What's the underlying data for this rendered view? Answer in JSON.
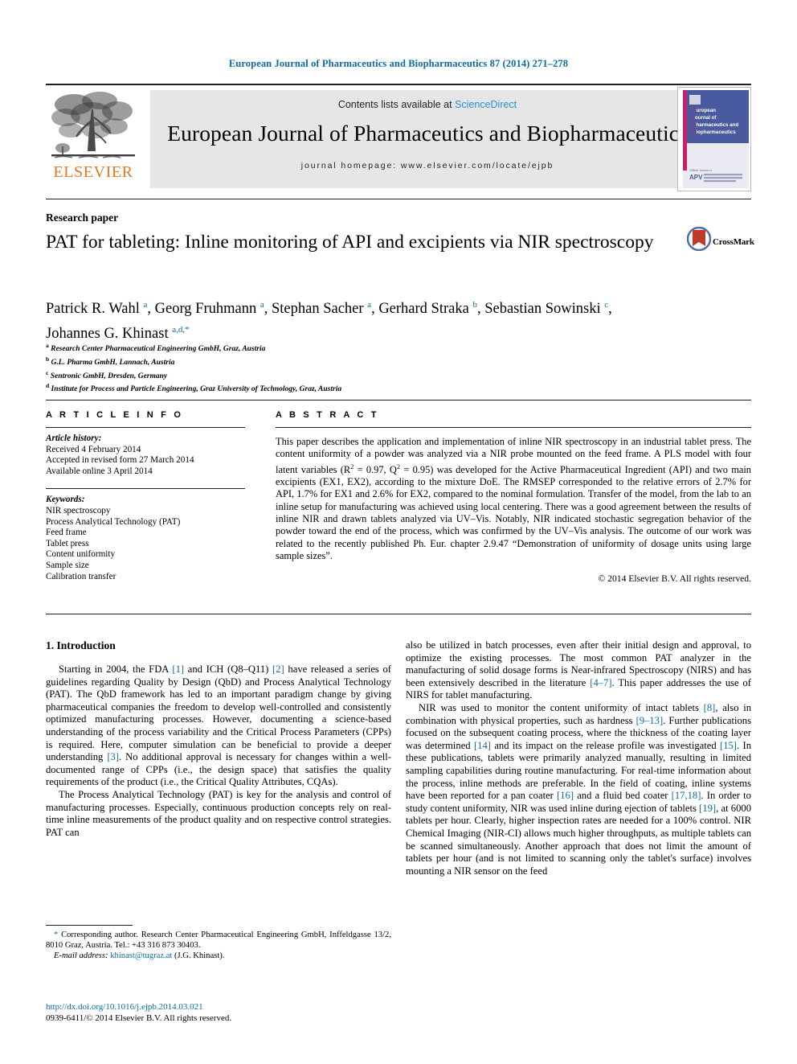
{
  "running_head": "European Journal of Pharmaceutics and Biopharmaceutics 87 (2014) 271–278",
  "masthead": {
    "publisher": "ELSEVIER",
    "contents_prefix": "Contents lists available at ",
    "sciencedirect": "ScienceDirect",
    "journal_title": "European Journal of Pharmaceutics and Biopharmaceutics",
    "homepage": "journal homepage: www.elsevier.com/locate/ejpb",
    "cover": {
      "line1": "european",
      "line2": "journal of",
      "line3": "pharmaceutics and",
      "line4": "biopharmaceutics",
      "footer_brand": "APV",
      "bg_color": "#4a5a9e",
      "stripe_color": "#cc1f6a"
    }
  },
  "article": {
    "type": "Research paper",
    "title": "PAT for tableting: Inline monitoring of API and excipients via NIR spectroscopy",
    "crossmark_label": "CrossMark",
    "authors_line1": "Patrick R. Wahl <sup>a</sup>, Georg Fruhmann <sup>a</sup>, Stephan Sacher <sup>a</sup>, Gerhard Straka <sup>b</sup>, Sebastian Sowinski <sup>c</sup>,",
    "authors_line2": "Johannes G. Khinast <sup>a,d,</sup><sup>*</sup>",
    "affiliations": [
      "<sup>a</sup> Research Center Pharmaceutical Engineering GmbH, Graz, Austria",
      "<sup>b</sup> G.L. Pharma GmbH, Lannach, Austria",
      "<sup>c</sup> Sentronic GmbH, Dresden, Germany",
      "<sup>d</sup> Institute for Process and Particle Engineering, Graz University of Technology, Graz, Austria"
    ]
  },
  "article_info": {
    "heading": "A R T I C L E   I N F O",
    "history_label": "Article history:",
    "history": [
      "Received 4 February 2014",
      "Accepted in revised form 27 March 2014",
      "Available online 3 April 2014"
    ],
    "keywords_label": "Keywords:",
    "keywords": [
      "NIR spectroscopy",
      "Process Analytical Technology (PAT)",
      "Feed frame",
      "Tablet press",
      "Content uniformity",
      "Sample size",
      "Calibration transfer"
    ]
  },
  "abstract": {
    "heading": "A B S T R A C T",
    "text": "This paper describes the application and implementation of inline NIR spectroscopy in an industrial tablet press. The content uniformity of a powder was analyzed via a NIR probe mounted on the feed frame. A PLS model with four latent variables (R<sup>2</sup> = 0.97, Q<sup>2</sup> = 0.95) was developed for the Active Pharmaceutical Ingredient (API) and two main excipients (EX1, EX2), according to the mixture DoE. The RMSEP corresponded to the relative errors of 2.7% for API, 1.7% for EX1 and 2.6% for EX2, compared to the nominal formulation. Transfer of the model, from the lab to an inline setup for manufacturing was achieved using local centering. There was a good agreement between the results of inline NIR and drawn tablets analyzed via UV–Vis. Notably, NIR indicated stochastic segregation behavior of the powder toward the end of the process, which was confirmed by the UV–Vis analysis. The outcome of our work was related to the recently published Ph. Eur. chapter 2.9.47 “Demonstration of uniformity of dosage units using large sample sizes”.",
    "copyright": "© 2014 Elsevier B.V. All rights reserved."
  },
  "body": {
    "section_heading": "1. Introduction",
    "left_paragraphs": [
      "Starting in 2004, the FDA <span class=\"ref\">[1]</span> and ICH (Q8–Q11) <span class=\"ref\">[2]</span> have released a series of guidelines regarding Quality by Design (QbD) and Process Analytical Technology (PAT). The QbD framework has led to an important paradigm change by giving pharmaceutical companies the freedom to develop well-controlled and consistently optimized manufacturing processes. However, documenting a science-based understanding of the process variability and the Critical Process Parameters (CPPs) is required. Here, computer simulation can be beneficial to provide a deeper understanding <span class=\"ref\">[3]</span>. No additional approval is necessary for changes within a well-documented range of CPPs (i.e., the design space) that satisfies the quality requirements of the product (i.e., the Critical Quality Attributes, CQAs).",
      "The Process Analytical Technology (PAT) is key for the analysis and control of manufacturing processes. Especially, continuous production concepts rely on real-time inline measurements of the product quality and on respective control strategies. PAT can"
    ],
    "right_paragraphs": [
      "also be utilized in batch processes, even after their initial design and approval, to optimize the existing processes. The most common PAT analyzer in the manufacturing of solid dosage forms is Near-infrared Spectroscopy (NIRS) and has been extensively described in the literature <span class=\"ref\">[4–7]</span>. This paper addresses the use of NIRS for tablet manufacturing.",
      "NIR was used to monitor the content uniformity of intact tablets <span class=\"ref\">[8]</span>, also in combination with physical properties, such as hardness <span class=\"ref\">[9–13]</span>. Further publications focused on the subsequent coating process, where the thickness of the coating layer was determined <span class=\"ref\">[14]</span> and its impact on the release profile was investigated <span class=\"ref\">[15]</span>. In these publications, tablets were primarily analyzed manually, resulting in limited sampling capabilities during routine manufacturing. For real-time information about the process, inline methods are preferable. In the field of coating, inline systems have been reported for a pan coater <span class=\"ref\">[16]</span> and a fluid bed coater <span class=\"ref\">[17,18]</span>. In order to study content uniformity, NIR was used inline during ejection of tablets <span class=\"ref\">[19]</span>, at 6000 tablets per hour. Clearly, higher inspection rates are needed for a 100% control. NIR Chemical Imaging (NIR-CI) allows much higher throughputs, as multiple tablets can be scanned simultaneously. Another approach that does not limit the amount of tablets per hour (and is not limited to scanning only the tablet's surface) involves mounting a NIR sensor on the feed"
    ]
  },
  "footnotes": {
    "corresponding": "<span class=\"ref\">*</span> Corresponding author. Research Center Pharmaceutical Engineering GmbH, Inffeldgasse 13/2, 8010 Graz, Austria. Tel.: +43 316 873 30403.",
    "email_label": "E-mail address:",
    "email": "khinast@tugraz.at",
    "email_suffix": " (J.G. Khinast)."
  },
  "imprint": {
    "doi": "http://dx.doi.org/10.1016/j.ejpb.2014.03.021",
    "issn_line": "0939-6411/© 2014 Elsevier B.V. All rights reserved."
  }
}
